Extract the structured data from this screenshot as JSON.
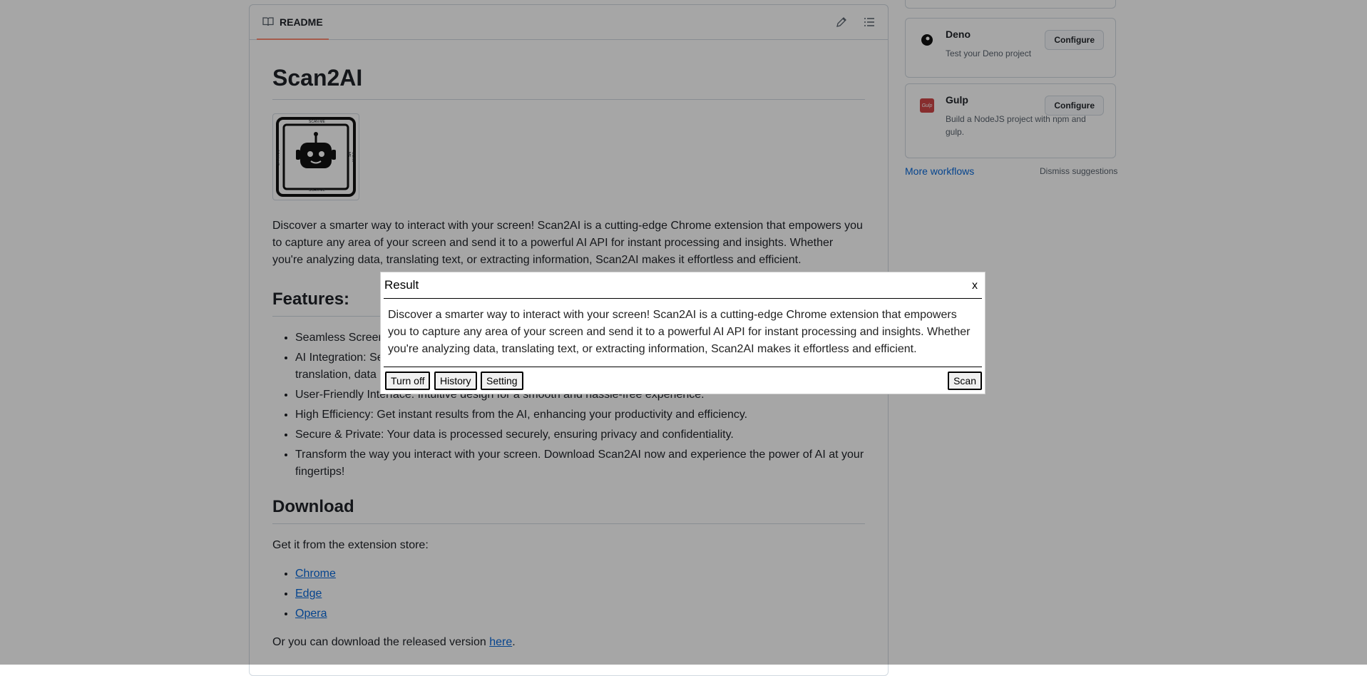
{
  "readme": {
    "tab_label": "README",
    "title": "Scan2AI",
    "logo": {
      "text_top": "SCAN ME",
      "text_bottom": "SCAN ME",
      "text_left": "SCAN ME",
      "text_right": "SCAN ME"
    },
    "intro": "Discover a smarter way to interact with your screen! Scan2AI is a cutting-edge Chrome extension that empowers you to capture any area of your screen and send it to a powerful AI API for instant processing and insights. Whether you're analyzing data, translating text, or extracting information, Scan2AI makes it effortless and efficient.",
    "features_heading": "Features:",
    "features": [
      "Seamless Screen",
      "AI Integration: Se",
      "translation, data",
      "User-Friendly Interface: Intuitive design for a smooth and hassle-free experience.",
      "High Efficiency: Get instant results from the AI, enhancing your productivity and efficiency.",
      "Secure & Private: Your data is processed securely, ensuring privacy and confidentiality.",
      "Transform the way you interact with your screen. Download Scan2AI now and experience the power of AI at your fingertips!"
    ],
    "download_heading": "Download",
    "download_text": "Get it from the extension store:",
    "stores": [
      "Chrome",
      "Edge",
      "Opera"
    ],
    "released_prefix": "Or you can download the released version ",
    "released_link": "here",
    "released_suffix": "."
  },
  "sidebar": {
    "deno": {
      "name": "Deno",
      "description": "Test your Deno project",
      "button": "Configure"
    },
    "gulp": {
      "name": "Gulp",
      "description": "Build a NodeJS project with npm and gulp.",
      "button": "Configure",
      "icon_text": "Gulp"
    },
    "more_workflows": "More workflows",
    "dismiss": "Dismiss suggestions"
  },
  "dialog": {
    "title": "Result",
    "close": "x",
    "body": "Discover a smarter way to interact with your screen! Scan2AI is a cutting-edge Chrome extension that empowers you to capture any area of your screen and send it to a powerful AI API for instant processing and insights. Whether you're analyzing data, translating text, or extracting information, Scan2AI makes it effortless and efficient.",
    "buttons": {
      "turn_off": "Turn off",
      "history": "History",
      "setting": "Setting",
      "scan": "Scan"
    }
  },
  "colors": {
    "accent_link": "#0969da",
    "tab_underline": "#fd8c73",
    "overlay": "rgba(0,0,0,0.35)"
  }
}
